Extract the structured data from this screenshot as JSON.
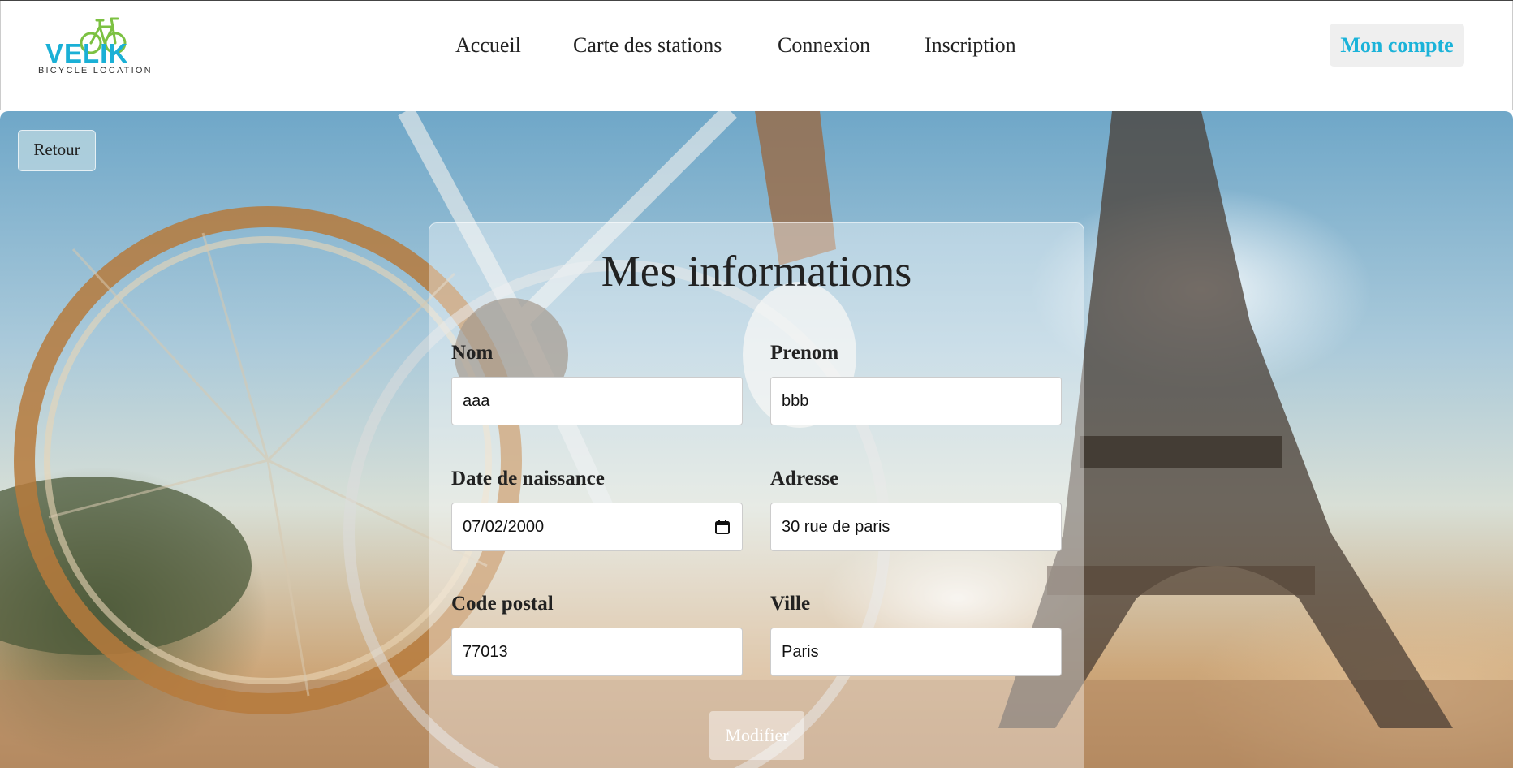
{
  "brand": {
    "name": "VELIK",
    "tagline": "BICYCLE LOCATION",
    "colors": {
      "primary": "#1ab0d6",
      "accent": "#7cc142"
    }
  },
  "nav": {
    "links": [
      "Accueil",
      "Carte des stations",
      "Connexion",
      "Inscription"
    ],
    "account_label": "Mon compte"
  },
  "back_label": "Retour",
  "form": {
    "title": "Mes informations",
    "fields": {
      "nom": {
        "label": "Nom",
        "value": "aaa"
      },
      "prenom": {
        "label": "Prenom",
        "value": "bbb"
      },
      "naissance": {
        "label": "Date de naissance",
        "value": "07/02/2000"
      },
      "adresse": {
        "label": "Adresse",
        "value": "30 rue de paris"
      },
      "code_postal": {
        "label": "Code postal",
        "value": "77013"
      },
      "ville": {
        "label": "Ville",
        "value": "Paris"
      }
    },
    "submit_label": "Modifier"
  },
  "icons": {
    "logo": "bicycle-icon",
    "date": "calendar-icon"
  }
}
